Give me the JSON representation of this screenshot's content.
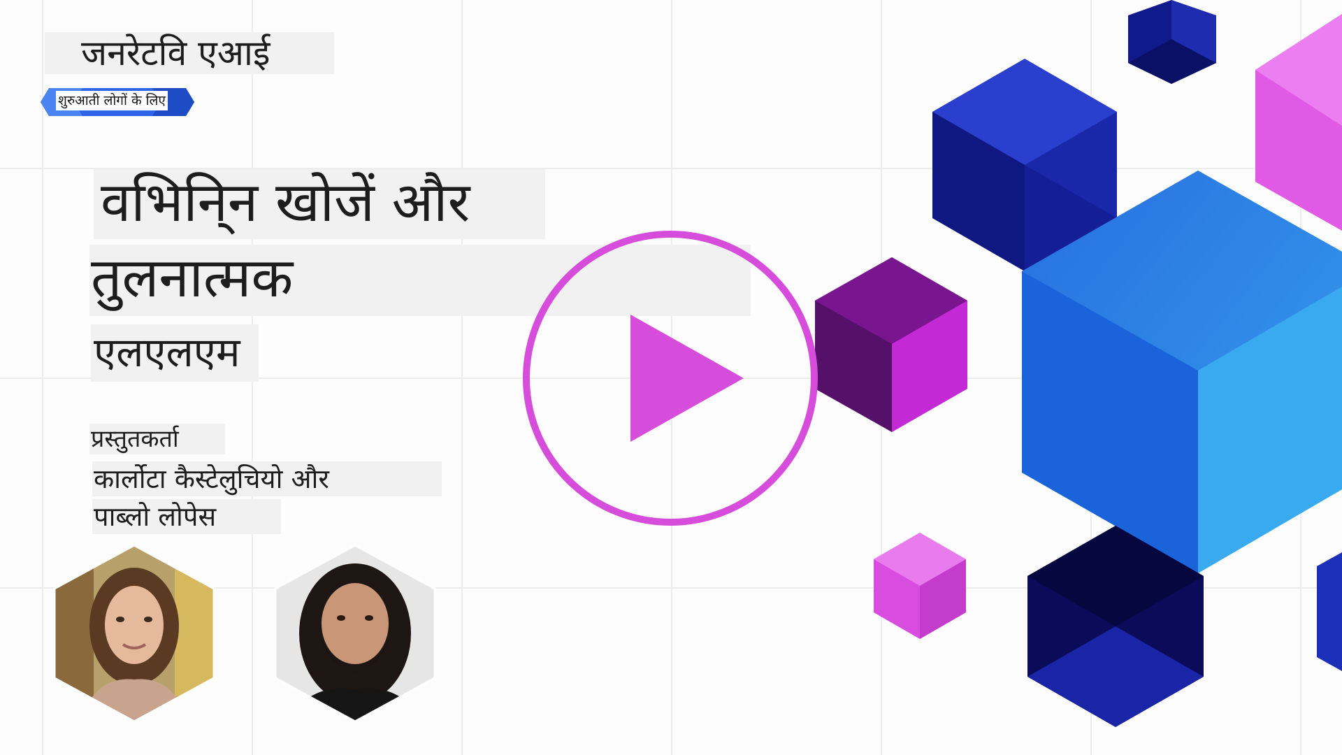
{
  "header": {
    "brand": "जनरेटवि एआई",
    "badge": "शुरुआती लोगों के लिए"
  },
  "lesson": {
    "title_line1": "वभिनि्न खोजें और",
    "title_line2": "तुलनात्मक",
    "title_line3": "एलएलएम"
  },
  "presenters": {
    "label": "प्रस्तुतकर्ता",
    "name_line1": "कार्लोटा कैस्टेलुचियो और",
    "name_line2": "पाब्लो लोपेस"
  },
  "video": {
    "play_icon": "play-icon",
    "accent_color": "#d64ddb"
  },
  "colors": {
    "background": "#fdfdfd",
    "grid": "#ececec",
    "ribbon_blue": "#2f63e8",
    "magenta": "#d64ddb",
    "deep_blue": "#1a1f9e",
    "bright_blue": "#2a8be6",
    "purple": "#7a1a8c"
  }
}
